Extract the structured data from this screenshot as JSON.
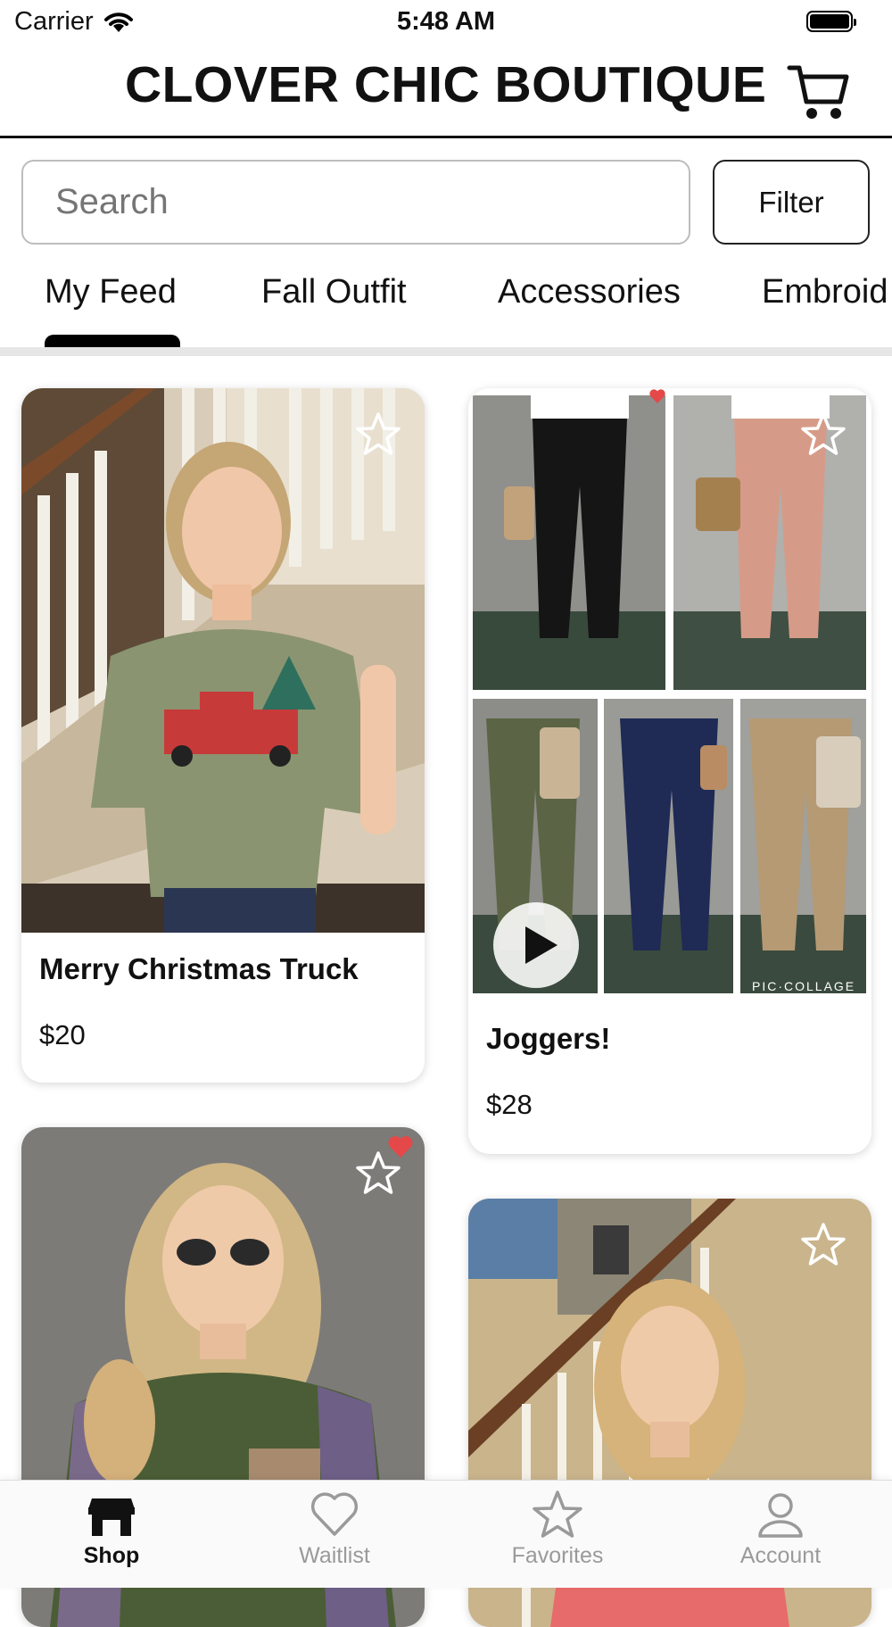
{
  "status_bar": {
    "carrier": "Carrier",
    "time": "5:48 AM"
  },
  "header": {
    "title": "CLOVER CHIC BOUTIQUE",
    "cart_icon": "cart-icon"
  },
  "search": {
    "placeholder": "Search",
    "value": ""
  },
  "filter": {
    "label": "Filter"
  },
  "tabs": [
    {
      "label": "My Feed",
      "active": true
    },
    {
      "label": "Fall Outfit",
      "active": false
    },
    {
      "label": "Accessories",
      "active": false
    },
    {
      "label": "Embroid",
      "active": false
    }
  ],
  "products": [
    {
      "title": "Merry Christmas Truck",
      "price": "$20"
    },
    {
      "title": "Joggers!",
      "price": "$28",
      "video_badge": "PIC·COLLAGE"
    },
    {
      "title": "",
      "price": ""
    },
    {
      "title": "",
      "price": ""
    }
  ],
  "colors": {
    "accent": "#000000",
    "heart": "#e54848",
    "inactive": "#9a9a9a"
  },
  "nav": [
    {
      "label": "Shop",
      "icon": "shop-icon",
      "active": true
    },
    {
      "label": "Waitlist",
      "icon": "heart-icon",
      "active": false
    },
    {
      "label": "Favorites",
      "icon": "star-icon",
      "active": false
    },
    {
      "label": "Account",
      "icon": "account-icon",
      "active": false
    }
  ]
}
